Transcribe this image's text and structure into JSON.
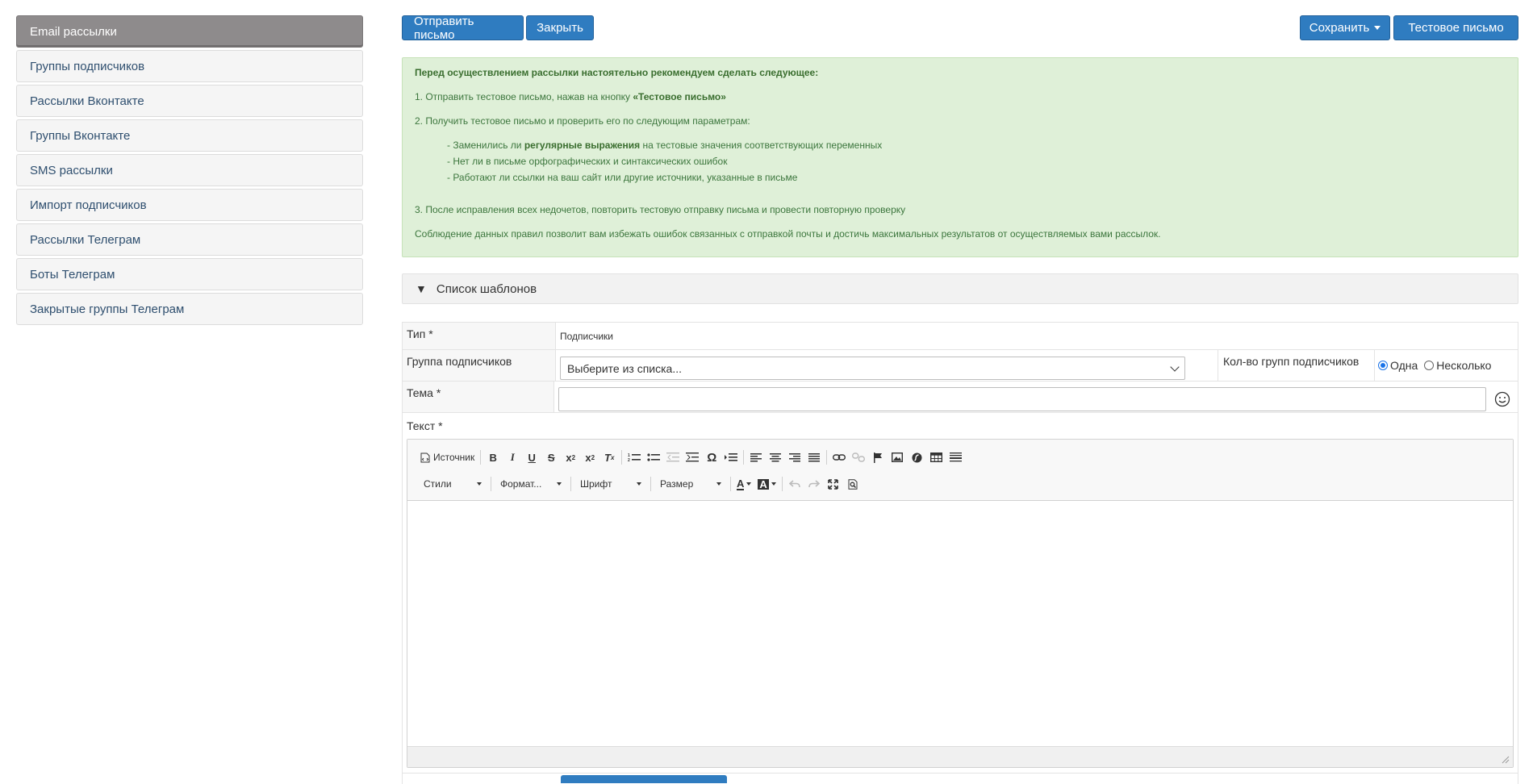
{
  "sidebar": {
    "items": [
      {
        "label": "Email рассылки",
        "active": true
      },
      {
        "label": "Группы подписчиков"
      },
      {
        "label": "Рассылки Вконтакте"
      },
      {
        "label": "Группы Вконтакте"
      },
      {
        "label": "SMS рассылки"
      },
      {
        "label": "Импорт подписчиков"
      },
      {
        "label": "Рассылки Телеграм"
      },
      {
        "label": "Боты Телеграм"
      },
      {
        "label": "Закрытые группы Телеграм"
      }
    ]
  },
  "toolbar": {
    "send_label": "Отправить письмо",
    "close_label": "Закрыть",
    "save_label": "Сохранить",
    "test_label": "Тестовое письмо"
  },
  "alert": {
    "heading": "Перед осуществлением рассылки настоятельно рекомендуем сделать следующее:",
    "step1_prefix": "1. Отправить тестовое письмо, нажав на кнопку ",
    "step1_bold": "«Тестовое письмо»",
    "step2": "2. Получить тестовое письмо и проверить его по следующим параметрам:",
    "check1_prefix": "- Заменились ли ",
    "check1_bold": "регулярные выражения",
    "check1_suffix": " на тестовые значения соответствующих переменных",
    "check2": "- Нет ли в письме орфографических и синтаксических ошибок",
    "check3": "- Работают ли ссылки на ваш сайт или другие источники, указанные в письме",
    "step3": "3. После исправления всех недочетов, повторить тестовую отправку письма и провести повторную проверку",
    "footer": "Соблюдение данных правил позволит вам избежать ошибок связанных с отправкой почты и достичь максимальных результатов от осуществляемых вами рассылок."
  },
  "templates": {
    "label": "Список шаблонов"
  },
  "form": {
    "type_label": "Тип *",
    "type_value": "Подписчики",
    "group_label": "Группа подписчиков",
    "group_placeholder": "Выберите из списка...",
    "group_count_label": "Кол-во групп подписчиков",
    "radio_one": "Одна",
    "radio_many": "Несколько",
    "subject_label": "Тема *",
    "text_label": "Текст *"
  },
  "editor": {
    "source_label": "Источник",
    "styles_label": "Стили",
    "format_label": "Формат...",
    "font_label": "Шрифт",
    "size_label": "Размер"
  }
}
